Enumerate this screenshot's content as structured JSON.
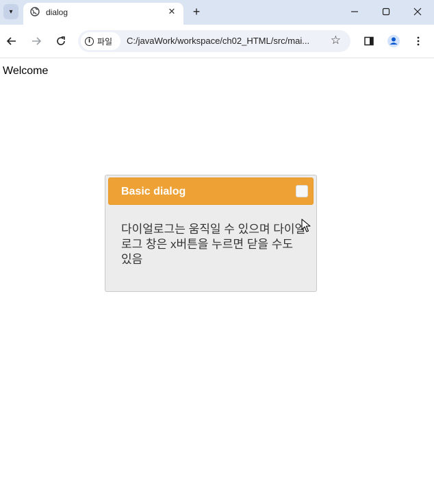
{
  "browser": {
    "tab_title": "dialog",
    "address_chip_label": "파일",
    "url": "C:/javaWork/workspace/ch02_HTML/src/mai...",
    "icons": {
      "tab_dropdown": "chevron-down-icon",
      "favicon": "globe-icon",
      "tab_close": "close-icon",
      "new_tab": "plus-icon",
      "minimize": "minimize-icon",
      "maximize": "maximize-icon",
      "close_window": "close-icon",
      "back": "arrow-left-icon",
      "forward": "arrow-right-icon",
      "reload": "reload-icon",
      "site_info": "info-icon",
      "bookmark": "star-icon",
      "side_panel": "side-panel-icon",
      "profile": "profile-icon",
      "menu": "kebab-menu-icon"
    }
  },
  "page": {
    "welcome_text": "Welcome"
  },
  "dialog": {
    "title": "Basic dialog",
    "body_text": "다이얼로그는 움직일 수 있으며 다이얼로그 창은 x버튼을 누르면 닫을 수도 있음",
    "colors": {
      "titlebar": "#eea236",
      "body": "#ececec"
    }
  }
}
